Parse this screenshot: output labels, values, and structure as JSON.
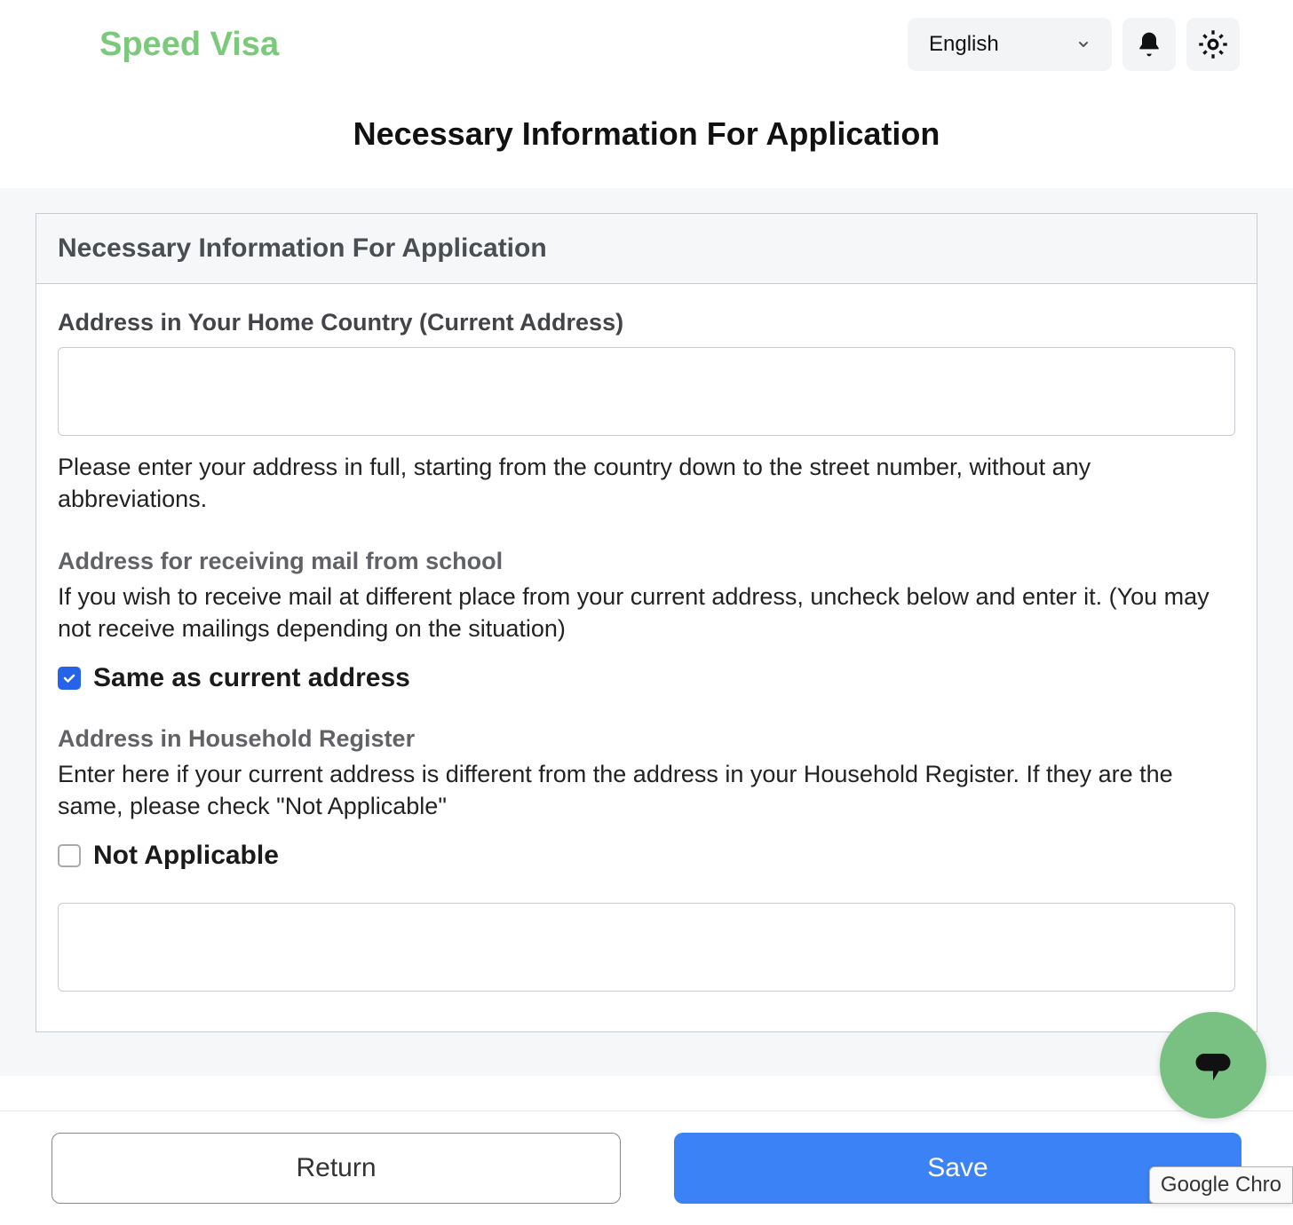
{
  "header": {
    "logo": "Speed Visa",
    "language": "English"
  },
  "page_title": "Necessary Information For Application",
  "panel": {
    "title": "Necessary Information For Application",
    "fields": {
      "home_address": {
        "label": "Address in Your Home Country (Current Address)",
        "value": "",
        "hint": "Please enter your address in full, starting from the country down to the street number, without any abbreviations."
      },
      "mail_address": {
        "label": "Address for receiving mail from school",
        "desc": "If you wish to receive mail at different place from your current address, uncheck below and enter it. (You may not receive mailings depending on the situation)",
        "checkbox_label": "Same as current address",
        "checked": true
      },
      "household_register": {
        "label": "Address in Household Register",
        "desc": "Enter here if your current address is different from the address in your Household Register. If they are the same, please check \"Not Applicable\"",
        "checkbox_label": "Not Applicable",
        "checked": false,
        "value": ""
      }
    }
  },
  "buttons": {
    "return": "Return",
    "save": "Save"
  },
  "tooltip": "Google Chro"
}
